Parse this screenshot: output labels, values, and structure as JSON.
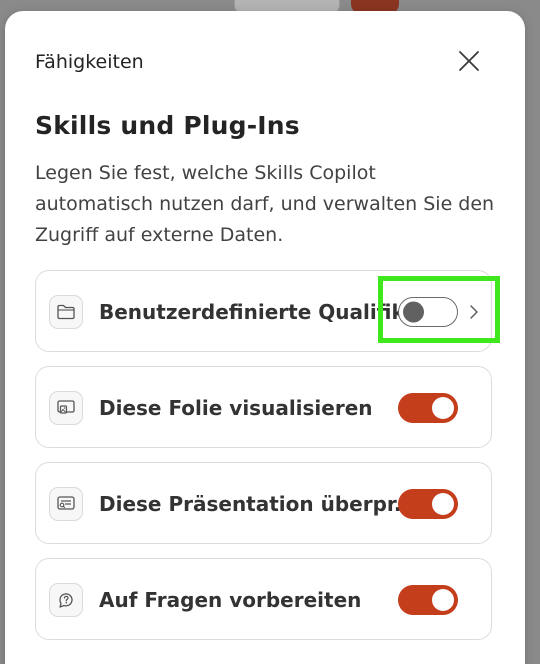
{
  "dialog": {
    "header": "Fähigkeiten",
    "title": "Skills und Plug-Ins",
    "description": "Legen Sie fest, welche Skills Copilot automatisch nutzen darf, und verwalten Sie den Zugriff auf externe Daten."
  },
  "skills": [
    {
      "label": "Benutzerdefinierte Qualifik...",
      "icon": "folder-icon",
      "enabled": false,
      "has_chevron": true
    },
    {
      "label": "Diese Folie visualisieren",
      "icon": "image-slide-icon",
      "enabled": true,
      "has_chevron": false
    },
    {
      "label": "Diese Präsentation überpr...",
      "icon": "review-list-icon",
      "enabled": true,
      "has_chevron": false
    },
    {
      "label": "Auf Fragen vorbereiten",
      "icon": "question-chat-icon",
      "enabled": true,
      "has_chevron": false
    }
  ],
  "colors": {
    "toggle_on": "#c43e1c",
    "highlight": "#3ee81c"
  }
}
